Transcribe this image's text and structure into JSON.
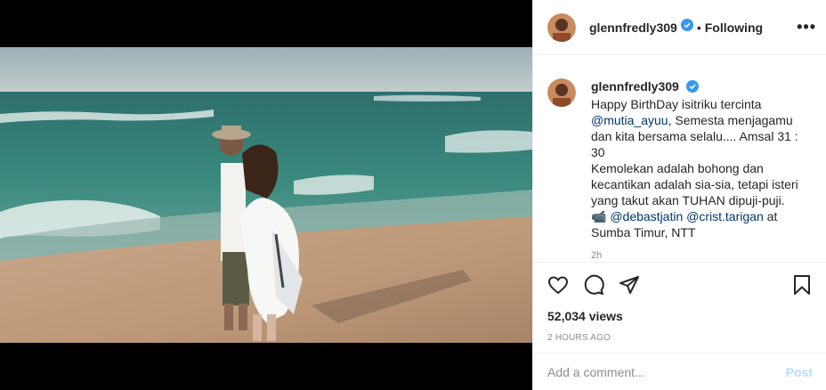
{
  "post": {
    "username": "glennfredly309",
    "follow_sep": "•",
    "follow_status": "Following",
    "more_label": "•••"
  },
  "caption": {
    "username": "glennfredly309",
    "text_1": "Happy BirthDay isitriku tercinta",
    "mention_1": "@mutia_ayuu",
    "text_2": ", Semesta menjagamu dan kita bersama selalu.... Amsal 31 : 30",
    "text_3": "Kemolekan adalah bohong dan kecantikan adalah sia-sia, tetapi isteri yang takut akan TUHAN dipuji-puji.",
    "camera_glyph": "📹",
    "mention_2": "@debastjatin",
    "mention_3": "@crist.tarigan",
    "text_4": " at Sumba Timur, NTT",
    "time": "2h"
  },
  "stats": {
    "views": "52,034 views",
    "ago": "2 HOURS AGO"
  },
  "comment": {
    "placeholder": "Add a comment...",
    "post_label": "Post"
  },
  "icons": {
    "like": "heart-icon",
    "comment": "comment-icon",
    "share": "share-icon",
    "save": "bookmark-icon",
    "verified": "verified-badge-icon"
  },
  "colors": {
    "verified": "#3897f0",
    "mention": "#00376b",
    "muted": "#8e8e8e",
    "post_disabled": "#b3dbff"
  }
}
